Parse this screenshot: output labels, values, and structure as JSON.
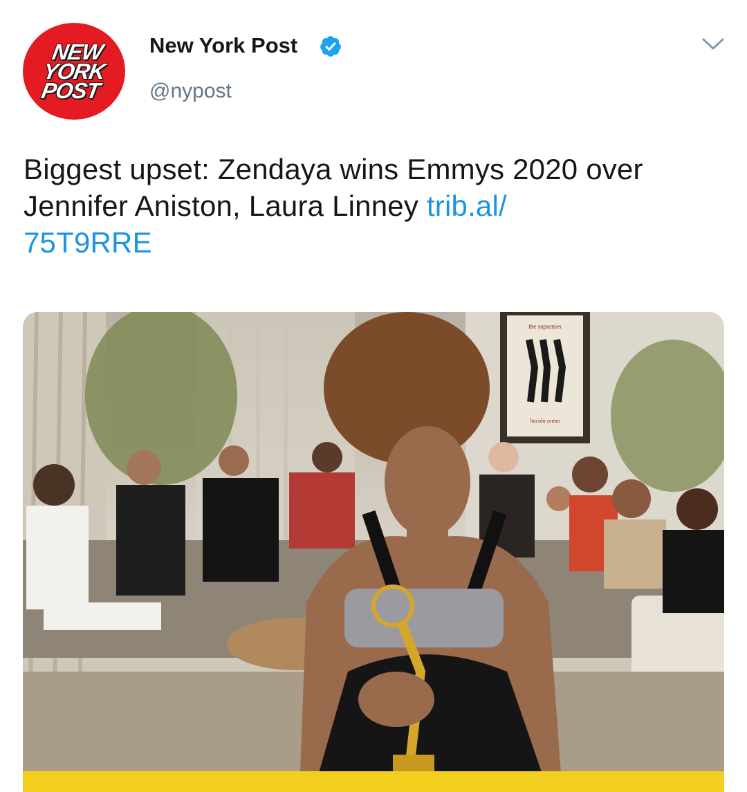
{
  "header": {
    "avatar_logo_lines": [
      "NEW",
      "YORK",
      "POST"
    ],
    "display_name": "New York Post",
    "handle": "@nypost",
    "verified_icon": "verified-badge-icon",
    "menu_icon": "chevron-down-icon"
  },
  "tweet": {
    "text": "Biggest upset: Zendaya wins Emmys 2020 over Jennifer Aniston, Laura Linney ",
    "link_line1": "trib.al/",
    "link_line2": "75T9RRE"
  },
  "media": {
    "poster_title": "the supremes",
    "poster_caption": "lincoln center"
  },
  "colors": {
    "brand_red": "#e41b23",
    "link_blue": "#1b95e0",
    "verified_blue": "#1da1f2",
    "text": "#14171a",
    "secondary_text": "#657786",
    "media_bar_yellow": "#f2cf1e"
  }
}
